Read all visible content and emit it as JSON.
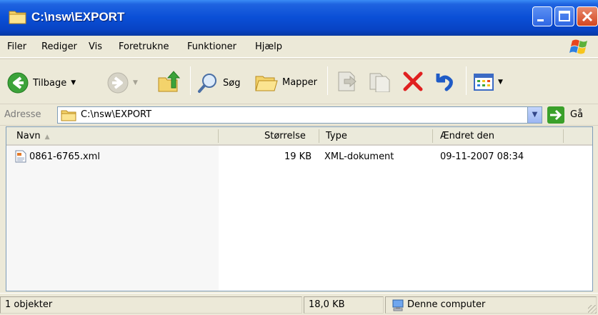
{
  "window": {
    "title": "C:\\nsw\\EXPORT"
  },
  "menu": {
    "items": [
      {
        "label": "Filer"
      },
      {
        "label": "Rediger"
      },
      {
        "label": "Vis"
      },
      {
        "label": "Foretrukne"
      },
      {
        "label": "Funktioner"
      },
      {
        "label": "Hjælp"
      }
    ]
  },
  "toolbar": {
    "back_label": "Tilbage",
    "search_label": "Søg",
    "folders_label": "Mapper"
  },
  "address": {
    "label": "Adresse",
    "path": "C:\\nsw\\EXPORT",
    "go_label": "Gå"
  },
  "columns": {
    "name": "Navn",
    "size": "Størrelse",
    "type": "Type",
    "modified": "Ændret den"
  },
  "files": [
    {
      "name": "0861-6765.xml",
      "size": "19 KB",
      "type": "XML-dokument",
      "modified": "09-11-2007 08:34"
    }
  ],
  "status": {
    "objects": "1 objekter",
    "size": "18,0 KB",
    "location": "Denne computer"
  },
  "colors": {
    "title_bar": "#0A4FD6",
    "close_button": "#D3461F",
    "delete_icon": "#E02020"
  }
}
